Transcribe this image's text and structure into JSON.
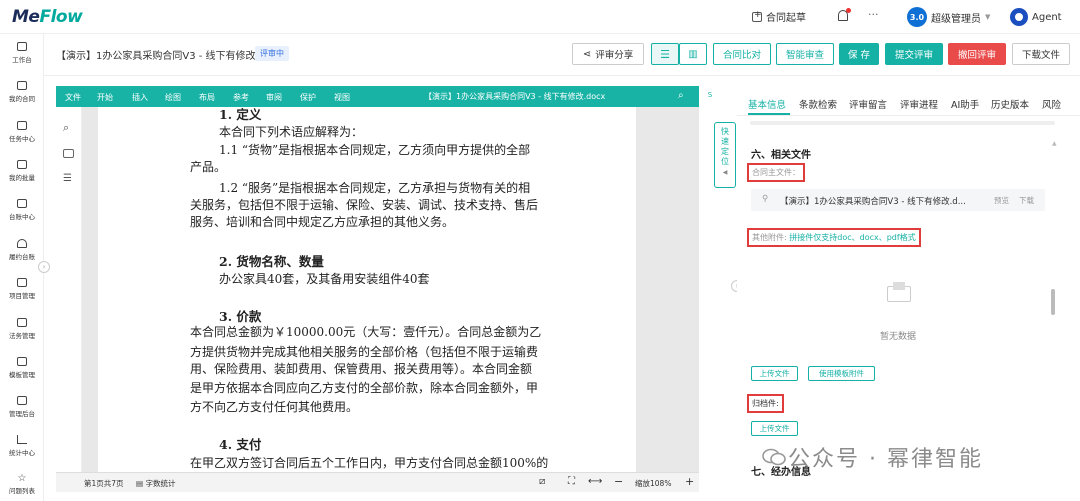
{
  "topbar": {
    "logo_main": "Me",
    "logo_accent": "Flow",
    "new_contract": "合同起草",
    "more": "···",
    "avatar_text": "3.0",
    "user_name": "超级管理员",
    "agent": "Agent"
  },
  "sidebar": {
    "items": [
      {
        "label": "工作台",
        "icon": "grid-icon"
      },
      {
        "label": "我的合同",
        "icon": "folder-icon"
      },
      {
        "label": "任务中心",
        "icon": "calendar-icon"
      },
      {
        "label": "我的批量",
        "icon": "list-icon"
      },
      {
        "label": "台账中心",
        "icon": "edit-icon"
      },
      {
        "label": "履约台账",
        "icon": "bell-icon"
      },
      {
        "label": "项目管理",
        "icon": "briefcase-icon"
      },
      {
        "label": "法务管理",
        "icon": "bank-icon"
      },
      {
        "label": "模板管理",
        "icon": "doc-icon"
      },
      {
        "label": "管理后台",
        "icon": "dashboard-icon"
      },
      {
        "label": "统计中心",
        "icon": "chart-icon"
      },
      {
        "label": "问题列表",
        "icon": "star-icon"
      }
    ]
  },
  "doc_header": {
    "title": "【演示】1办公家具采购合同V3 - 线下有修改",
    "status": "评审中",
    "share": "评审分享",
    "compare": "合同比对",
    "smart_review": "智能审查",
    "save": "保 存",
    "submit": "提交评审",
    "withdraw": "撤回评审",
    "download": "下载文件"
  },
  "editor": {
    "menu": [
      "文件",
      "开始",
      "插入",
      "绘图",
      "布局",
      "参考",
      "审阅",
      "保护",
      "视图"
    ],
    "filename": "【演示】1办公家具采购合同V3 - 线下有修改.docx",
    "quick_locate": "快速定位",
    "page_info": "第1页共7页",
    "word_count": "字数统计",
    "zoom": "缩放108%",
    "lines": [
      "1. 定义",
      "本合同下列术语应解释为：",
      "1.1  “货物”是指根据本合同规定，乙方须向甲方提供的全部",
      "产品。",
      "1.2  “服务”是指根据本合同规定，乙方承担与货物有关的相",
      "关服务，包括但不限于运输、保险、安装、调试、技术支持、售后",
      "服务、培训和合同中规定乙方应承担的其他义务。",
      "2. 货物名称、数量",
      "办公家具40套，及其备用安装组件40套",
      "3. 价款",
      "本合同总金额为￥10000.00元（大写：壹仟元）。合同总金额为乙",
      "方提供货物并完成其他相关服务的全部价格（包括但不限于运输费",
      "用、保险费用、装卸费用、保管费用、报关费用等）。本合同金额",
      "是甲方依据本合同应向乙方支付的全部价款，除本合同金额外，甲",
      "方不向乙方支付任何其他费用。",
      "4. 支付",
      "在甲乙双方签订合同后五个工作日内，甲方支付合同总金额100%的"
    ]
  },
  "right_panel": {
    "tabs": [
      "基本信息",
      "条款检索",
      "评审留言",
      "评审进程",
      "AI助手",
      "历史版本",
      "风险"
    ],
    "section6": "六、相关文件",
    "main_file_label": "合同主文件：",
    "main_file_name": "【演示】1办公家具采购合同V3 - 线下有修改.d...",
    "preview": "预览",
    "download": "下载",
    "other_attach_label": "其他附件:",
    "other_attach_hint": "拼接件仅支持doc、docx、pdf格式",
    "empty": "暂无数据",
    "upload": "上传文件",
    "use_template": "使用模板附件",
    "archive_label": "归档件:",
    "upload2": "上传文件",
    "section7": "七、经办信息"
  },
  "watermark": "公众号 · 幂律智能"
}
